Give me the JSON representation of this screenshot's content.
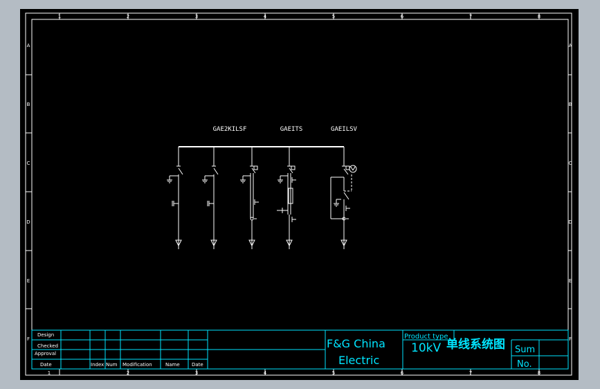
{
  "colors": {
    "app_bg": "#b4bcc4",
    "canvas_bg": "#000000",
    "border": "#ffffff",
    "title_block_lines": "#00e5ff",
    "labels": "#ffffff"
  },
  "border": {
    "column_markers_top": [
      "1",
      "2",
      "3",
      "4",
      "5",
      "6",
      "7",
      "8"
    ],
    "column_markers_bottom": [
      "1",
      "2",
      "3",
      "4",
      "5",
      "6",
      "7",
      "8"
    ],
    "row_markers": [
      "A",
      "B",
      "C",
      "D",
      "E",
      "F"
    ]
  },
  "diagram": {
    "cabinet_labels": [
      "GAE2KILSF",
      "GAEITS",
      "GAEILSV"
    ]
  },
  "title_block": {
    "rows": [
      "Design",
      "Checked",
      "Approval",
      "Date"
    ],
    "columns": [
      "Index",
      "Num",
      "Modification",
      "Name",
      "Date"
    ],
    "company_line1": "F&G China",
    "company_line2": "Electric",
    "product_type_label": "Product type",
    "product_name": "10kV",
    "drawing_title": "单线系统图",
    "sum_label": "Sum",
    "no_label": "No."
  }
}
